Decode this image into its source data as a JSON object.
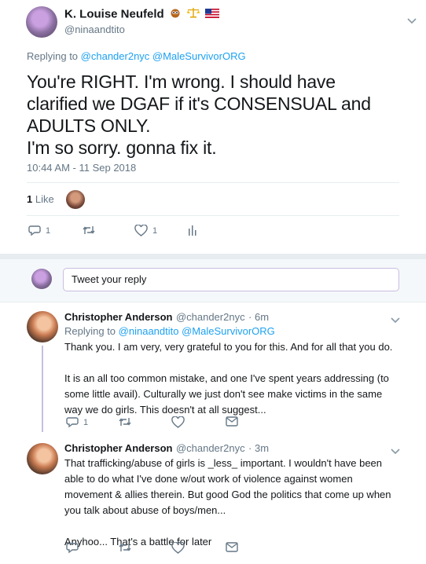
{
  "main_tweet": {
    "author_name": "K. Louise Neufeld",
    "author_handle": "@ninaandtito",
    "replying_prefix": "Replying to",
    "replying_to": "@chander2nyc @MaleSurvivorORG",
    "text_lines": [
      "You're RIGHT. I'm wrong. I should have",
      "clarified we DGAF if it's CONSENSUAL and",
      "ADULTS ONLY.",
      "I'm so sorry. gonna fix it."
    ],
    "timestamp": "10:44 AM - 11 Sep 2018",
    "like_count": "1",
    "like_label": "Like",
    "actions": {
      "reply_count": "1",
      "retweet_count": "",
      "like_count": "1"
    }
  },
  "reply_box": {
    "placeholder": "Tweet your reply"
  },
  "replies": [
    {
      "author_name": "Christopher Anderson",
      "author_handle": "@chander2nyc",
      "time": "· 6m",
      "replying_prefix": "Replying to",
      "replying_to": "@ninaandtito @MaleSurvivorORG",
      "paragraphs": [
        "Thank you. I am very, very grateful to you for this. And for all that you do.",
        "It is an all too common mistake, and one I've spent years addressing (to some little avail). Culturally we just don't see make victims in the same way we do girls. This doesn't at all suggest..."
      ],
      "reply_count": "1"
    },
    {
      "author_name": "Christopher Anderson",
      "author_handle": "@chander2nyc",
      "time": "· 3m",
      "paragraphs": [
        "That trafficking/abuse of girls is _less_ important. I wouldn't have been able to do what I've done w/out work of violence against women movement & allies therein. But good God the politics that come up when you talk about abuse of boys/men...",
        "Anyhoo... That's a battle for later"
      ],
      "reply_count": ""
    }
  ],
  "colors": {
    "link": "#1da1f2",
    "secondary_text": "#657786",
    "divider": "#e6ecf0",
    "thread_line": "#c9bde0"
  }
}
